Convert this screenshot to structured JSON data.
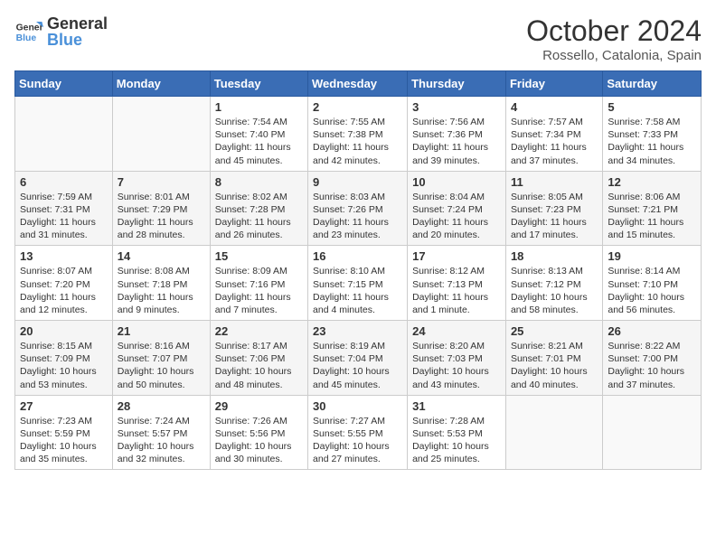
{
  "logo": {
    "line1": "General",
    "line2": "Blue"
  },
  "title": "October 2024",
  "location": "Rossello, Catalonia, Spain",
  "days_header": [
    "Sunday",
    "Monday",
    "Tuesday",
    "Wednesday",
    "Thursday",
    "Friday",
    "Saturday"
  ],
  "weeks": [
    [
      {
        "day": "",
        "info": ""
      },
      {
        "day": "",
        "info": ""
      },
      {
        "day": "1",
        "info": "Sunrise: 7:54 AM\nSunset: 7:40 PM\nDaylight: 11 hours and 45 minutes."
      },
      {
        "day": "2",
        "info": "Sunrise: 7:55 AM\nSunset: 7:38 PM\nDaylight: 11 hours and 42 minutes."
      },
      {
        "day": "3",
        "info": "Sunrise: 7:56 AM\nSunset: 7:36 PM\nDaylight: 11 hours and 39 minutes."
      },
      {
        "day": "4",
        "info": "Sunrise: 7:57 AM\nSunset: 7:34 PM\nDaylight: 11 hours and 37 minutes."
      },
      {
        "day": "5",
        "info": "Sunrise: 7:58 AM\nSunset: 7:33 PM\nDaylight: 11 hours and 34 minutes."
      }
    ],
    [
      {
        "day": "6",
        "info": "Sunrise: 7:59 AM\nSunset: 7:31 PM\nDaylight: 11 hours and 31 minutes."
      },
      {
        "day": "7",
        "info": "Sunrise: 8:01 AM\nSunset: 7:29 PM\nDaylight: 11 hours and 28 minutes."
      },
      {
        "day": "8",
        "info": "Sunrise: 8:02 AM\nSunset: 7:28 PM\nDaylight: 11 hours and 26 minutes."
      },
      {
        "day": "9",
        "info": "Sunrise: 8:03 AM\nSunset: 7:26 PM\nDaylight: 11 hours and 23 minutes."
      },
      {
        "day": "10",
        "info": "Sunrise: 8:04 AM\nSunset: 7:24 PM\nDaylight: 11 hours and 20 minutes."
      },
      {
        "day": "11",
        "info": "Sunrise: 8:05 AM\nSunset: 7:23 PM\nDaylight: 11 hours and 17 minutes."
      },
      {
        "day": "12",
        "info": "Sunrise: 8:06 AM\nSunset: 7:21 PM\nDaylight: 11 hours and 15 minutes."
      }
    ],
    [
      {
        "day": "13",
        "info": "Sunrise: 8:07 AM\nSunset: 7:20 PM\nDaylight: 11 hours and 12 minutes."
      },
      {
        "day": "14",
        "info": "Sunrise: 8:08 AM\nSunset: 7:18 PM\nDaylight: 11 hours and 9 minutes."
      },
      {
        "day": "15",
        "info": "Sunrise: 8:09 AM\nSunset: 7:16 PM\nDaylight: 11 hours and 7 minutes."
      },
      {
        "day": "16",
        "info": "Sunrise: 8:10 AM\nSunset: 7:15 PM\nDaylight: 11 hours and 4 minutes."
      },
      {
        "day": "17",
        "info": "Sunrise: 8:12 AM\nSunset: 7:13 PM\nDaylight: 11 hours and 1 minute."
      },
      {
        "day": "18",
        "info": "Sunrise: 8:13 AM\nSunset: 7:12 PM\nDaylight: 10 hours and 58 minutes."
      },
      {
        "day": "19",
        "info": "Sunrise: 8:14 AM\nSunset: 7:10 PM\nDaylight: 10 hours and 56 minutes."
      }
    ],
    [
      {
        "day": "20",
        "info": "Sunrise: 8:15 AM\nSunset: 7:09 PM\nDaylight: 10 hours and 53 minutes."
      },
      {
        "day": "21",
        "info": "Sunrise: 8:16 AM\nSunset: 7:07 PM\nDaylight: 10 hours and 50 minutes."
      },
      {
        "day": "22",
        "info": "Sunrise: 8:17 AM\nSunset: 7:06 PM\nDaylight: 10 hours and 48 minutes."
      },
      {
        "day": "23",
        "info": "Sunrise: 8:19 AM\nSunset: 7:04 PM\nDaylight: 10 hours and 45 minutes."
      },
      {
        "day": "24",
        "info": "Sunrise: 8:20 AM\nSunset: 7:03 PM\nDaylight: 10 hours and 43 minutes."
      },
      {
        "day": "25",
        "info": "Sunrise: 8:21 AM\nSunset: 7:01 PM\nDaylight: 10 hours and 40 minutes."
      },
      {
        "day": "26",
        "info": "Sunrise: 8:22 AM\nSunset: 7:00 PM\nDaylight: 10 hours and 37 minutes."
      }
    ],
    [
      {
        "day": "27",
        "info": "Sunrise: 7:23 AM\nSunset: 5:59 PM\nDaylight: 10 hours and 35 minutes."
      },
      {
        "day": "28",
        "info": "Sunrise: 7:24 AM\nSunset: 5:57 PM\nDaylight: 10 hours and 32 minutes."
      },
      {
        "day": "29",
        "info": "Sunrise: 7:26 AM\nSunset: 5:56 PM\nDaylight: 10 hours and 30 minutes."
      },
      {
        "day": "30",
        "info": "Sunrise: 7:27 AM\nSunset: 5:55 PM\nDaylight: 10 hours and 27 minutes."
      },
      {
        "day": "31",
        "info": "Sunrise: 7:28 AM\nSunset: 5:53 PM\nDaylight: 10 hours and 25 minutes."
      },
      {
        "day": "",
        "info": ""
      },
      {
        "day": "",
        "info": ""
      }
    ]
  ]
}
